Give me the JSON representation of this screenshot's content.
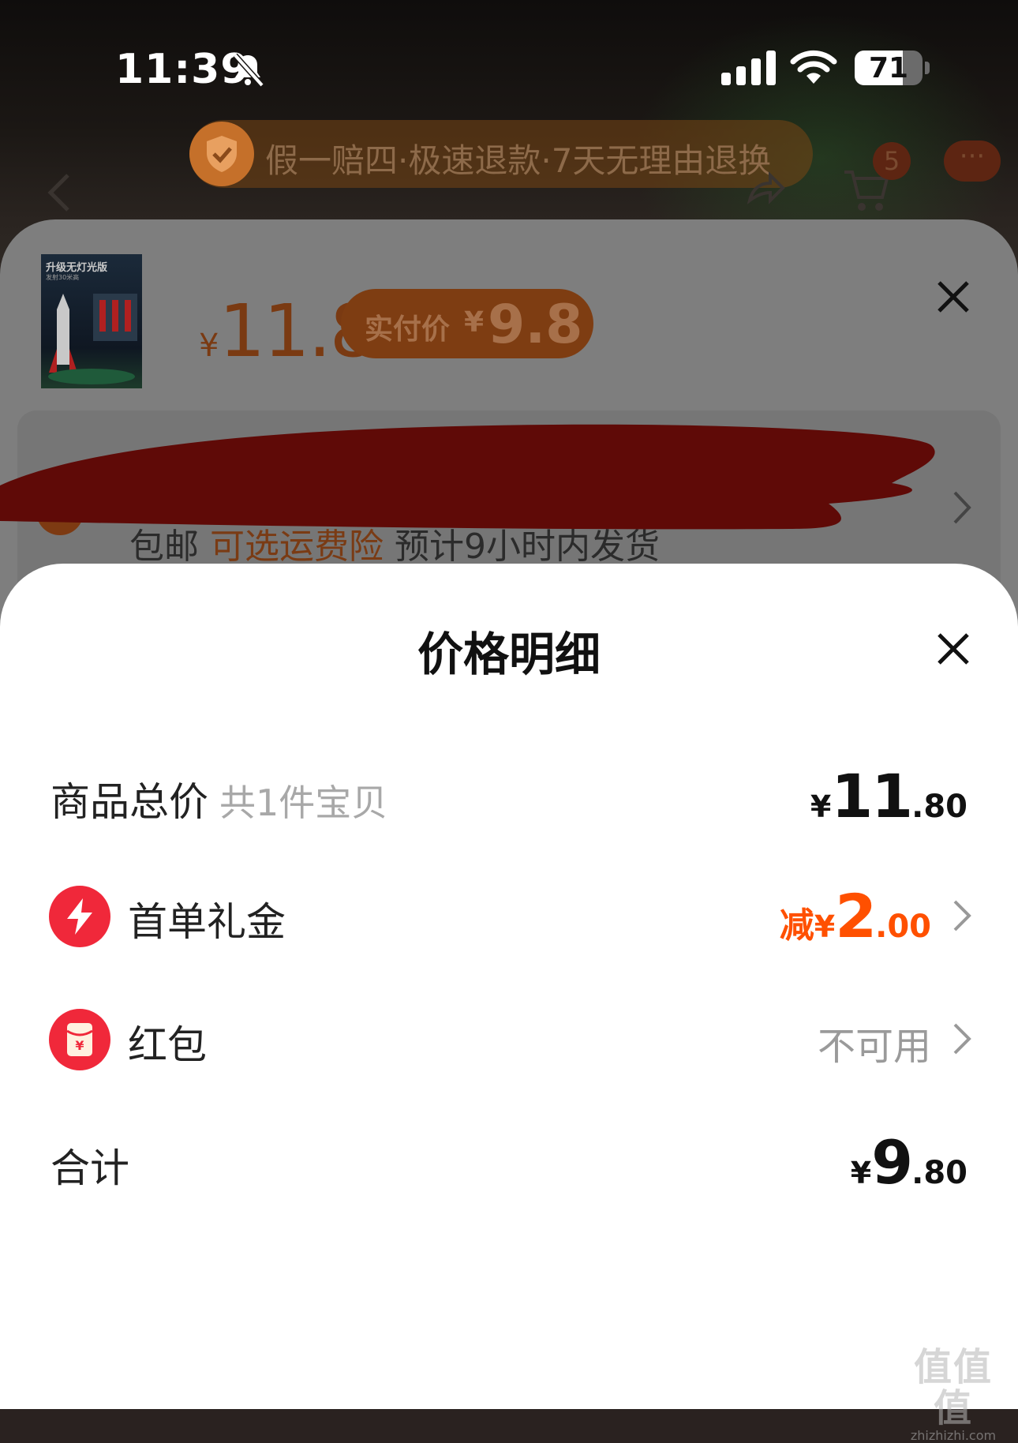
{
  "status_bar": {
    "time": "11:39",
    "battery_level": "71",
    "battery_fraction": 0.71
  },
  "guarantee_banner": {
    "text": "假一赔四·极速退款·7天无理由退换"
  },
  "header": {
    "cart_count": "5",
    "more_label": "···"
  },
  "product": {
    "thumbnail_title": "升级无灯光版",
    "thumbnail_sub": "发射30米高",
    "currency": "¥",
    "price": "11.8",
    "pay_label": "实付价",
    "pay_price": "9.8"
  },
  "shipping": {
    "free_label": "包邮",
    "insurance_label": "可选运费险",
    "eta": "预计9小时内发货"
  },
  "price_detail": {
    "title": "价格明细",
    "rows": [
      {
        "label": "商品总价",
        "sub": "共1件宝贝",
        "currency": "¥",
        "int": "11",
        "dec": ".80"
      },
      {
        "label": "首单礼金",
        "prefix": "减",
        "currency": "¥",
        "int": "2",
        "dec": ".00"
      },
      {
        "label": "红包",
        "status": "不可用"
      },
      {
        "label": "合计",
        "currency": "¥",
        "int": "9",
        "dec": ".80"
      }
    ]
  },
  "colors": {
    "accent": "#ff5000",
    "icon_red": "#f0283a",
    "muted": "#9a9a9a"
  },
  "watermark": {
    "glyphs": "值值值",
    "url": "zhizhizhi.com"
  }
}
